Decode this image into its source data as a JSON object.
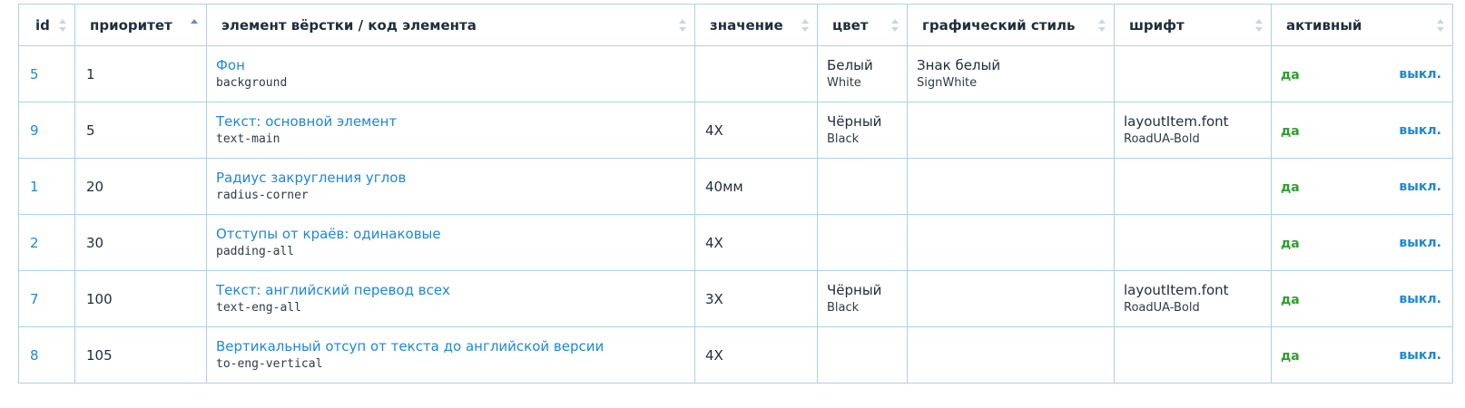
{
  "columns": [
    {
      "key": "id",
      "label": "id",
      "sort": "none"
    },
    {
      "key": "priority",
      "label": "приоритет",
      "sort": "asc"
    },
    {
      "key": "element",
      "label": "элемент вёрстки / код элемента",
      "sort": "none"
    },
    {
      "key": "value",
      "label": "значение",
      "sort": "none"
    },
    {
      "key": "color",
      "label": "цвет",
      "sort": "none"
    },
    {
      "key": "style",
      "label": "графический стиль",
      "sort": "none"
    },
    {
      "key": "font",
      "label": "шрифт",
      "sort": "none"
    },
    {
      "key": "active",
      "label": "активный",
      "sort": "none"
    }
  ],
  "rows": [
    {
      "id": "5",
      "priority": "1",
      "element_name": "Фон",
      "element_code": "background",
      "value": "",
      "color_name": "Белый",
      "color_code": "White",
      "style_name": "Знак белый",
      "style_code": "SignWhite",
      "font_name": "",
      "font_code": "",
      "active": "да",
      "toggle": "выкл."
    },
    {
      "id": "9",
      "priority": "5",
      "element_name": "Текст: основной элемент",
      "element_code": "text-main",
      "value": "4X",
      "color_name": "Чёрный",
      "color_code": "Black",
      "style_name": "",
      "style_code": "",
      "font_name": "layoutItem.font",
      "font_code": "RoadUA-Bold",
      "active": "да",
      "toggle": "выкл."
    },
    {
      "id": "1",
      "priority": "20",
      "element_name": "Радиус закругления углов",
      "element_code": "radius-corner",
      "value": "40мм",
      "color_name": "",
      "color_code": "",
      "style_name": "",
      "style_code": "",
      "font_name": "",
      "font_code": "",
      "active": "да",
      "toggle": "выкл."
    },
    {
      "id": "2",
      "priority": "30",
      "element_name": "Отступы от краёв: одинаковые",
      "element_code": "padding-all",
      "value": "4X",
      "color_name": "",
      "color_code": "",
      "style_name": "",
      "style_code": "",
      "font_name": "",
      "font_code": "",
      "active": "да",
      "toggle": "выкл."
    },
    {
      "id": "7",
      "priority": "100",
      "element_name": "Текст: английский перевод всех",
      "element_code": "text-eng-all",
      "value": "3X",
      "color_name": "Чёрный",
      "color_code": "Black",
      "style_name": "",
      "style_code": "",
      "font_name": "layoutItem.font",
      "font_code": "RoadUA-Bold",
      "active": "да",
      "toggle": "выкл."
    },
    {
      "id": "8",
      "priority": "105",
      "element_name": "Вертикальный отсуп от текста до английской версии",
      "element_code": "to-eng-vertical",
      "value": "4X",
      "color_name": "",
      "color_code": "",
      "style_name": "",
      "style_code": "",
      "font_name": "",
      "font_code": "",
      "active": "да",
      "toggle": "выкл."
    }
  ],
  "colors": {
    "link": "#1e88d6",
    "active_yes": "#2e9e2e",
    "border": "#a9d3e6",
    "header_rule": "#4e6a80",
    "sort_active": "#6a85c9",
    "sort_inactive": "#cbd5dd"
  },
  "icons": {
    "sort": "sort-arrows-icon"
  }
}
